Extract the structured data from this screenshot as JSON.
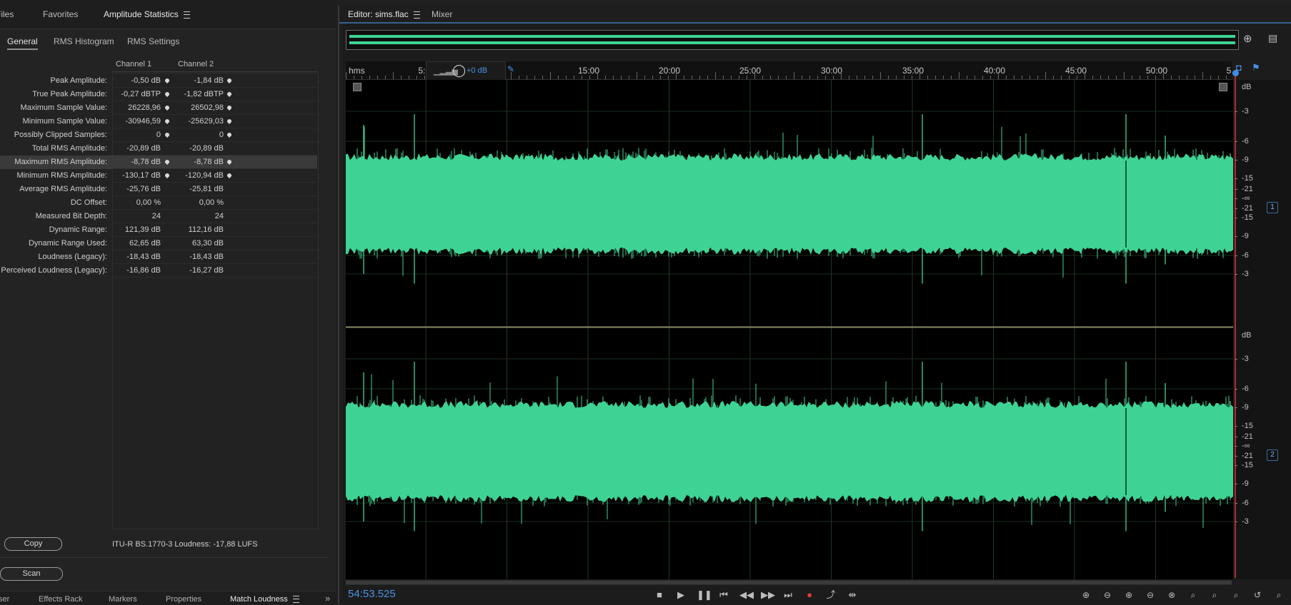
{
  "left_panel": {
    "tabs": [
      {
        "label": "Files"
      },
      {
        "label": "Favorites"
      },
      {
        "label": "Amplitude Statistics"
      }
    ],
    "subtabs": [
      {
        "label": "General"
      },
      {
        "label": "RMS Histogram"
      },
      {
        "label": "RMS Settings"
      }
    ],
    "columns": {
      "ch1": "Channel 1",
      "ch2": "Channel 2"
    },
    "rows": [
      {
        "label": "Peak Amplitude:",
        "v1": "-0,50 dB",
        "v2": "-1,84 dB",
        "marker": true
      },
      {
        "label": "True Peak Amplitude:",
        "v1": "-0,27 dBTP",
        "v2": "-1,82 dBTP",
        "marker": true
      },
      {
        "label": "Maximum Sample Value:",
        "v1": "26228,96",
        "v2": "26502,98",
        "marker": true
      },
      {
        "label": "Minimum Sample Value:",
        "v1": "-30946,59",
        "v2": "-25629,03",
        "marker": true
      },
      {
        "label": "Possibly Clipped Samples:",
        "v1": "0",
        "v2": "0",
        "marker": true
      },
      {
        "label": "Total RMS Amplitude:",
        "v1": "-20,89 dB",
        "v2": "-20,89 dB",
        "marker": false
      },
      {
        "label": "Maximum RMS Amplitude:",
        "v1": "-8,78 dB",
        "v2": "-8,78 dB",
        "marker": true
      },
      {
        "label": "Minimum RMS Amplitude:",
        "v1": "-130,17 dB",
        "v2": "-120,94 dB",
        "marker": true
      },
      {
        "label": "Average RMS Amplitude:",
        "v1": "-25,76 dB",
        "v2": "-25,81 dB",
        "marker": false
      },
      {
        "label": "DC Offset:",
        "v1": "0,00 %",
        "v2": "0,00 %",
        "marker": false
      },
      {
        "label": "Measured Bit Depth:",
        "v1": "24",
        "v2": "24",
        "marker": false
      },
      {
        "label": "Dynamic Range:",
        "v1": "121,39 dB",
        "v2": "112,16 dB",
        "marker": false
      },
      {
        "label": "Dynamic Range Used:",
        "v1": "62,65 dB",
        "v2": "63,30 dB",
        "marker": false
      },
      {
        "label": "Loudness (Legacy):",
        "v1": "-18,43 dB",
        "v2": "-18,43 dB",
        "marker": false
      },
      {
        "label": "Perceived Loudness (Legacy):",
        "v1": "-16,86 dB",
        "v2": "-16,27 dB",
        "marker": false
      }
    ],
    "copy_label": "Copy",
    "scan_label": "Scan",
    "loudness_text": "ITU-R BS.1770-3 Loudness:  -17,88 LUFS",
    "bottom_tabs": [
      {
        "label": "ser"
      },
      {
        "label": "Effects Rack"
      },
      {
        "label": "Markers"
      },
      {
        "label": "Properties"
      },
      {
        "label": "Match Loudness"
      }
    ]
  },
  "editor": {
    "tab_label": "Editor: sims.flac",
    "mixer_label": "Mixer",
    "ruler_unit": "hms",
    "gain_label": "+0 dB",
    "ticks": [
      "5:00",
      "15:00",
      "20:00",
      "25:00",
      "30:00",
      "35:00",
      "40:00",
      "45:00",
      "50:00",
      "5"
    ],
    "db_unit": "dB",
    "db_labels_ch": [
      "-3",
      "-6",
      "-9",
      "-15",
      "-21",
      "-∞",
      "-21",
      "-15",
      "-9",
      "-6",
      "-3"
    ],
    "channels": [
      "1",
      "2"
    ],
    "timecode": "54:53.525",
    "colors": {
      "waveform": "#3ed394",
      "timecode": "#4a93e6"
    }
  }
}
